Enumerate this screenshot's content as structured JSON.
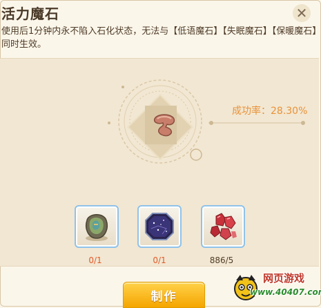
{
  "window": {
    "title": "活力魔石",
    "close_label": "✕"
  },
  "item": {
    "description": "使用后1分钟内永不陷入石化状态，无法与【低语魔石】【失眠魔石】【保暖魔石】同时生效。",
    "success_rate_text": "成功率：28.30%"
  },
  "materials": [
    {
      "name": "green-ore",
      "count": "0/1",
      "count_color": "#e05a2a"
    },
    {
      "name": "purple-crystal",
      "count": "0/1",
      "count_color": "#e05a2a"
    },
    {
      "name": "red-gems",
      "count": "886/5",
      "count_color": "#4f3c28"
    }
  ],
  "actions": {
    "make_label": "制作"
  },
  "watermark": {
    "top": "网页游戏",
    "bottom": "www.40407.com"
  },
  "colors": {
    "accent": "#e8923a",
    "slot_border": "#8fc2ea",
    "button": "#f5a500"
  }
}
